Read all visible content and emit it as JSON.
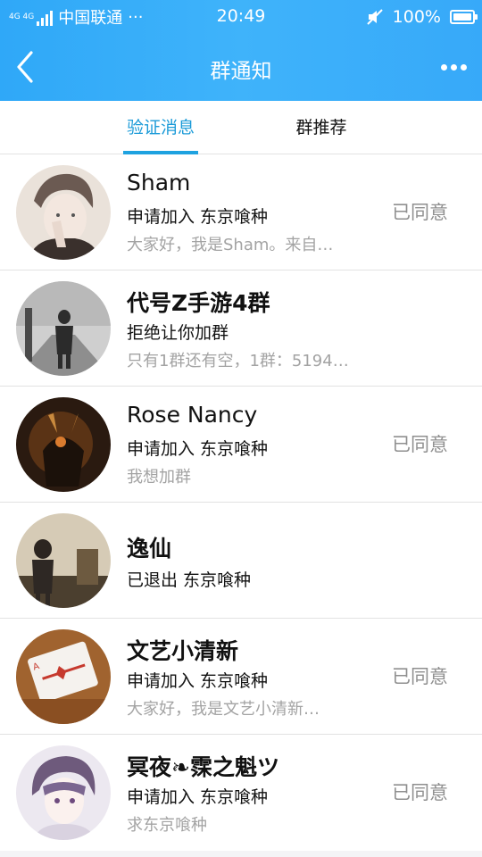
{
  "statusbar": {
    "net_top": "4G 4G",
    "carrier": "中国联通",
    "carrier_more": "···",
    "time": "20:49",
    "battery": "100%"
  },
  "navbar": {
    "title": "群通知"
  },
  "tabs": [
    {
      "label": "验证消息",
      "active": true
    },
    {
      "label": "群推荐",
      "active": false
    }
  ],
  "notifications": [
    {
      "name": "Sham",
      "action": "申请加入 东京喰种",
      "message": "大家好，我是Sham。来自…",
      "status": "已同意"
    },
    {
      "name": "代号Z手游4群",
      "action": "拒绝让你加群",
      "message": "只有1群还有空，1群：5194…",
      "status": ""
    },
    {
      "name": "Rose Nancy",
      "action": "申请加入 东京喰种",
      "message": "我想加群",
      "status": "已同意"
    },
    {
      "name": "逸仙",
      "action": "已退出 东京喰种",
      "message": "",
      "status": ""
    },
    {
      "name": "文艺小清新",
      "action": "申请加入 东京喰种",
      "message": "大家好，我是文艺小清新…",
      "status": "已同意"
    },
    {
      "name": "冥夜❧霂之魁ツ",
      "action": "申请加入 东京喰种",
      "message": "求东京喰种",
      "status": "已同意"
    }
  ]
}
